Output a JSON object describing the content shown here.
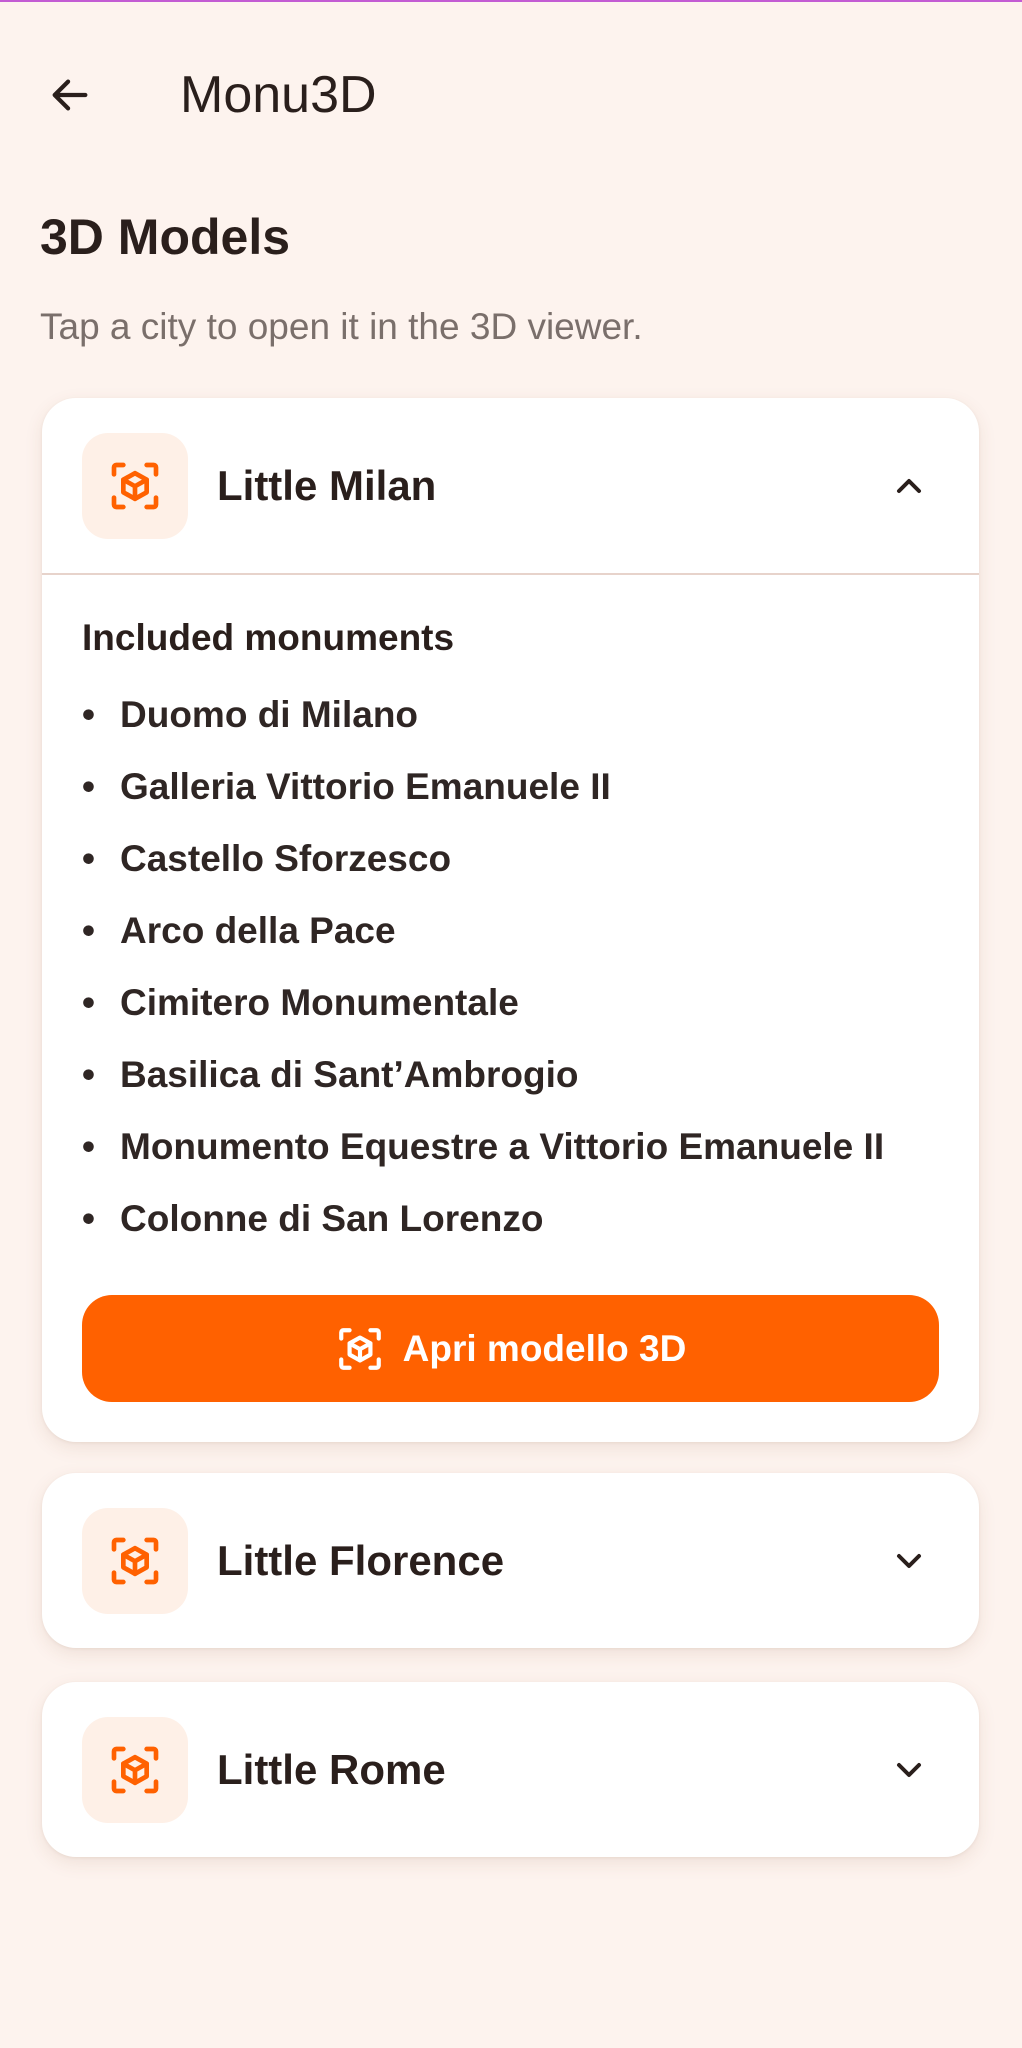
{
  "app_bar": {
    "title": "Monu3D",
    "back_icon": "arrow-left-icon"
  },
  "header": {
    "title": "3D Models",
    "subtitle": "Tap a city to open it in the 3D viewer."
  },
  "colors": {
    "accent": "#ff6100",
    "background": "#fdf3ee",
    "card": "#ffffff",
    "icon_tile": "#fef0e7"
  },
  "cities": [
    {
      "name": "Little Milan",
      "expanded": true,
      "icon": "cube-scan-icon",
      "chevron": "chevron-up-icon",
      "included_heading": "Included monuments",
      "monuments": [
        "Duomo di Milano",
        "Galleria Vittorio Emanuele II",
        "Castello Sforzesco",
        "Arco della Pace",
        "Cimitero Monumentale",
        "Basilica di Sant’Ambrogio",
        "Monumento Equestre a Vittorio Emanuele II",
        "Colonne di San Lorenzo"
      ],
      "button_label": "Apri modello 3D"
    },
    {
      "name": "Little Florence",
      "expanded": false,
      "icon": "cube-scan-icon",
      "chevron": "chevron-down-icon"
    },
    {
      "name": "Little Rome",
      "expanded": false,
      "icon": "cube-scan-icon",
      "chevron": "chevron-down-icon"
    }
  ]
}
